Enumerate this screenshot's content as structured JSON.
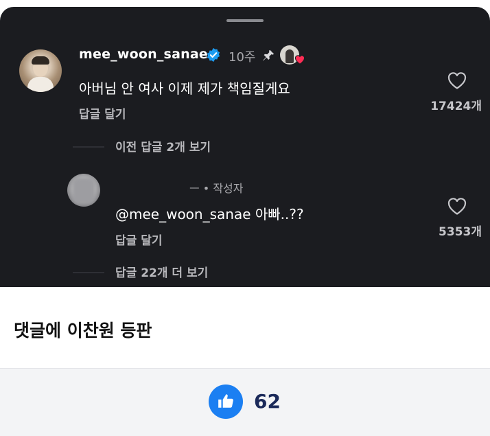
{
  "comment": {
    "username": "mee_woon_sanae",
    "time": "10주",
    "text": "아버님 안 여사 이제 제가 책임질게요",
    "reply_label": "답글 달기",
    "like_count": "17424개",
    "view_previous": "이전 답글 2개 보기"
  },
  "reply": {
    "author": "ㅡ • 작성자",
    "text": "@mee_woon_sanae 아빠..??",
    "reply_label": "답글 달기",
    "like_count": "5353개",
    "view_more": "답글 22개 더 보기"
  },
  "post": {
    "caption": "댓글에 이찬원 등판",
    "like_total": "62"
  },
  "colors": {
    "panel": "#1b1c20",
    "verified": "#1d9bf0",
    "heart_badge": "#ff2d55",
    "like_button": "#1b7ff2"
  },
  "icons": {
    "verified": "verified-badge-icon",
    "pin": "pin-icon",
    "heart": "heart-icon",
    "thumbs_up": "thumbs-up-icon"
  }
}
